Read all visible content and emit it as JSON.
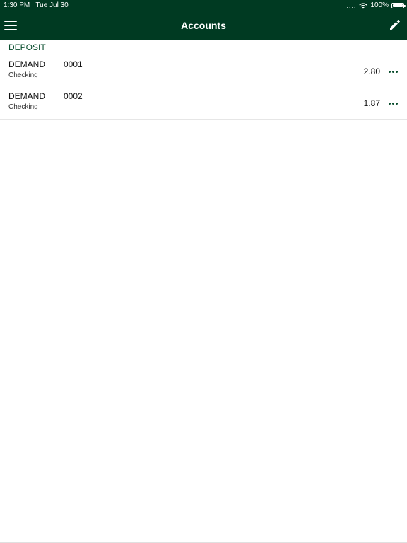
{
  "status_bar": {
    "time": "1:30 PM",
    "date": "Tue Jul 30",
    "signal_dots": "....",
    "battery": "100%"
  },
  "nav": {
    "title": "Accounts"
  },
  "sections": [
    {
      "header": "DEPOSIT",
      "accounts": [
        {
          "type": "DEMAND",
          "number": "0001",
          "subtype": "Checking",
          "balance": "2.80"
        },
        {
          "type": "DEMAND",
          "number": "0002",
          "subtype": "Checking",
          "balance": "1.87"
        }
      ]
    }
  ],
  "colors": {
    "header_bg": "#003a22",
    "accent": "#0a4d2e"
  }
}
